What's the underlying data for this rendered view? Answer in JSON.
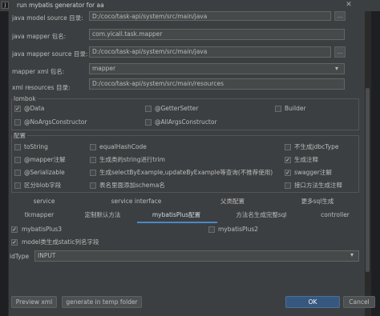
{
  "window": {
    "title": "run mybatis generator for aa",
    "close_glyph": "✕",
    "app_icon_letter": "J"
  },
  "form": {
    "model_source": {
      "label": "java model source 目录:",
      "value": "D:/coco/task-api/system/src/main/java"
    },
    "mapper_package": {
      "label": "java mapper 包名:",
      "value": "com.yicall.task.mapper"
    },
    "mapper_source": {
      "label": "java mapper source 目录:",
      "value": "D:/coco/task-api/system/src/main/java"
    },
    "mapper_xml_package": {
      "label": "mapper xml 包名:",
      "value": "mapper"
    },
    "xml_resources": {
      "label": "xml resources 目录:",
      "value": "D:/coco/task-api/system/src/main/resources"
    },
    "browse_glyph": "▾",
    "ellipsis_glyph": "...",
    "dropdown_glyph": "▾"
  },
  "lombok": {
    "title": "lombok",
    "items": [
      {
        "label": "@Data",
        "checked": true
      },
      {
        "label": "@GetterSetter",
        "checked": false
      },
      {
        "label": "Builder",
        "checked": false
      },
      {
        "label": "@NoArgsConstructor",
        "checked": false
      },
      {
        "label": "@AllArgsConstructor",
        "checked": false
      }
    ]
  },
  "config": {
    "title": "配置",
    "items": [
      {
        "label": "toString",
        "checked": false
      },
      {
        "label": "equalHashCode",
        "checked": false
      },
      {
        "label": "不生成jdbcType",
        "checked": false
      },
      {
        "label": "@mapper注解",
        "checked": false
      },
      {
        "label": "生成类的string进行trim",
        "checked": false
      },
      {
        "label": "生成注释",
        "checked": true
      },
      {
        "label": "@Serializable",
        "checked": false
      },
      {
        "label": "生成selectByExample,updateByExample等查询(不推荐使用)",
        "checked": false
      },
      {
        "label": "swagger注解",
        "checked": true
      },
      {
        "label": "区分blob字段",
        "checked": false
      },
      {
        "label": "表名里面添加schema名",
        "checked": false
      },
      {
        "label": "接口方法生成注释",
        "checked": false
      }
    ]
  },
  "tabs_row1": [
    "service",
    "service interface",
    "父类配置",
    "更多sql生成"
  ],
  "tabs_row2": [
    "tkmapper",
    "定制默认方法",
    "mybatisPlus配置",
    "方法名生成完整sql",
    "controller"
  ],
  "active_tab": "mybatisPlus配置",
  "mybatis_plus": {
    "plus3": {
      "label": "mybatisPlus3",
      "checked": true
    },
    "plus2": {
      "label": "mybatisPlus2",
      "checked": false
    },
    "static_field": {
      "label": "model类生成static列名字段",
      "checked": true
    },
    "id_type_label": "idType",
    "id_type_value": "INPUT"
  },
  "buttons": {
    "preview": "Preview xml",
    "temp": "generate in temp folder",
    "ok": "OK",
    "cancel": "Cancel"
  },
  "checkmark": "✓"
}
